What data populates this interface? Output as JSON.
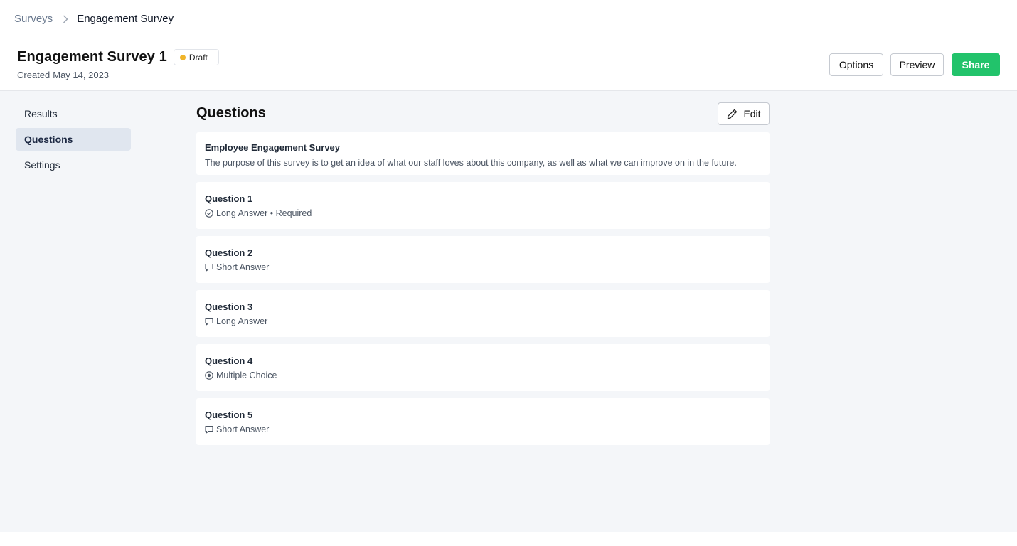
{
  "breadcrumb": {
    "root": "Surveys",
    "current": "Engagement Survey"
  },
  "header": {
    "title": "Engagement Survey 1",
    "status": "Draft",
    "created_prefix": "Created",
    "created_date": "May 14, 2023"
  },
  "actions": {
    "options": "Options",
    "preview": "Preview",
    "share": "Share"
  },
  "sidenav": {
    "items": [
      {
        "label": "Results"
      },
      {
        "label": "Questions"
      },
      {
        "label": "Settings"
      }
    ],
    "active": "Questions"
  },
  "content": {
    "title": "Questions",
    "edit_label": "Edit",
    "intro": {
      "title": "Employee Engagement Survey",
      "description": "The purpose of this survey is to get an idea of what our staff loves about this company, as well as what we can improve on in the future."
    },
    "questions": [
      {
        "title": "Question 1",
        "type": "Long Answer • Required",
        "icon": "check-circle-icon"
      },
      {
        "title": "Question 2",
        "type": "Short Answer",
        "icon": "comment-icon"
      },
      {
        "title": "Question 3",
        "type": "Long Answer",
        "icon": "comment-icon"
      },
      {
        "title": "Question 4",
        "type": "Multiple Choice",
        "icon": "radio-icon"
      },
      {
        "title": "Question 5",
        "type": "Short Answer",
        "icon": "comment-icon"
      }
    ]
  },
  "colors": {
    "accent_green": "#22c36b",
    "draft_dot": "#f0b429",
    "page_bg": "#f4f6f9",
    "active_nav_bg": "#e0e6ef"
  }
}
